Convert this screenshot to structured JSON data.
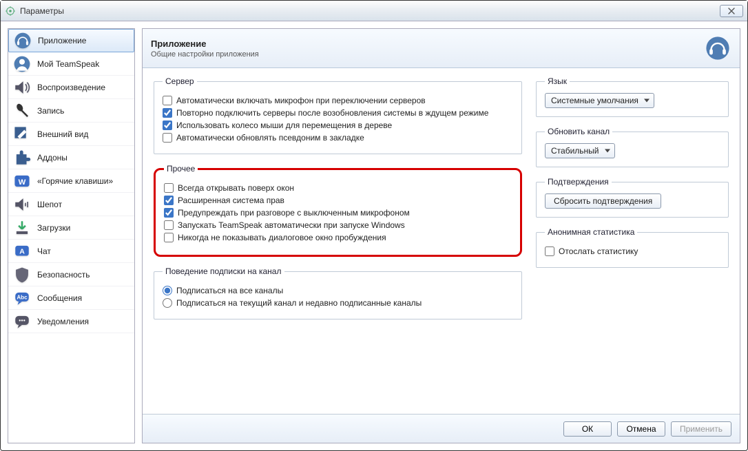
{
  "window": {
    "title": "Параметры"
  },
  "sidebar": {
    "items": [
      {
        "label": "Приложение"
      },
      {
        "label": "Мой TeamSpeak"
      },
      {
        "label": "Воспроизведение"
      },
      {
        "label": "Запись"
      },
      {
        "label": "Внешний вид"
      },
      {
        "label": "Аддоны"
      },
      {
        "label": "«Горячие клавиши»"
      },
      {
        "label": "Шепот"
      },
      {
        "label": "Загрузки"
      },
      {
        "label": "Чат"
      },
      {
        "label": "Безопасность"
      },
      {
        "label": "Сообщения"
      },
      {
        "label": "Уведомления"
      }
    ]
  },
  "header": {
    "title": "Приложение",
    "subtitle": "Общие настройки приложения"
  },
  "groups": {
    "server": {
      "legend": "Сервер",
      "opts": [
        {
          "label": "Автоматически включать микрофон при переключении серверов",
          "checked": false
        },
        {
          "label": "Повторно подключить серверы после возобновления системы в ждущем режиме",
          "checked": true
        },
        {
          "label": "Использовать колесо мыши для перемещения в дереве",
          "checked": true
        },
        {
          "label": "Автоматически обновлять псевдоним в закладке",
          "checked": false
        }
      ]
    },
    "misc": {
      "legend": "Прочее",
      "opts": [
        {
          "label": "Всегда открывать поверх окон",
          "checked": false
        },
        {
          "label": "Расширенная система прав",
          "checked": true
        },
        {
          "label": "Предупреждать при разговоре с выключенным микрофоном",
          "checked": true
        },
        {
          "label": "Запускать TeamSpeak автоматически при запуске Windows",
          "checked": false
        },
        {
          "label": "Никогда не показывать диалоговое окно пробуждения",
          "checked": false
        }
      ]
    },
    "subscribe": {
      "legend": "Поведение подписки на канал",
      "opts": [
        {
          "label": "Подписаться на все каналы"
        },
        {
          "label": "Подписаться на текущий канал и недавно подписанные каналы"
        }
      ],
      "selected": 0
    },
    "language": {
      "legend": "Язык",
      "value": "Системные умолчания"
    },
    "update": {
      "legend": "Обновить канал",
      "value": "Стабильный"
    },
    "confirm": {
      "legend": "Подтверждения",
      "button": "Сбросить подтверждения"
    },
    "anon": {
      "legend": "Анонимная статистика",
      "opt": {
        "label": "Отослать статистику",
        "checked": false
      }
    }
  },
  "footer": {
    "ok": "ОК",
    "cancel": "Отмена",
    "apply": "Применить"
  }
}
